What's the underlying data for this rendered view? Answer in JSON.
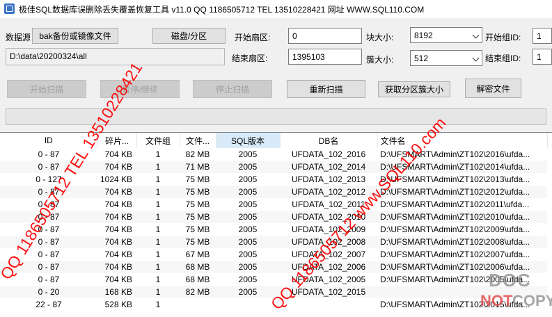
{
  "window": {
    "title": "极佳SQL数据库误删除丢失覆盖恢复工具 v11.0 QQ 1186505712 TEL 13510228421 网址 WWW.SQL110.COM",
    "icon": "app-icon"
  },
  "form": {
    "datasource_label": "数据源",
    "bak_button": "bak备份或镜像文件",
    "disk_button": "磁盘/分区",
    "path_value": "D:\\data\\20200324\\all",
    "start_sector_label": "开始扇区:",
    "start_sector_value": "0",
    "end_sector_label": "结束扇区:",
    "end_sector_value": "1395103",
    "block_size_label": "块大小:",
    "block_size_value": "8192",
    "cluster_size_label": "簇大小:",
    "cluster_size_value": "512",
    "start_group_label": "开始组ID:",
    "start_group_value": "1",
    "end_group_label": "结束组ID:",
    "end_group_value": "1"
  },
  "toolbar": {
    "start_scan": "开始扫描",
    "pause_resume": "暂停/继续",
    "stop_scan": "停止扫描",
    "rescan": "重新扫描",
    "get_cluster_size": "获取分区簇大小",
    "decrypt_file": "解密文件"
  },
  "progress": {
    "value": 0
  },
  "table": {
    "columns": [
      "ID",
      "碎片...",
      "文件组",
      "文件...",
      "SQL版本",
      "DB名",
      "文件名"
    ],
    "rows": [
      [
        "0 - 87",
        "704 KB",
        "1",
        "82 MB",
        "2005",
        "UFDATA_102_2016",
        "D:\\UFSMART\\Admin\\ZT102\\2016\\ufda..."
      ],
      [
        "0 - 87",
        "704 KB",
        "1",
        "71 MB",
        "2005",
        "UFDATA_102_2014",
        "D:\\UFSMART\\Admin\\ZT102\\2014\\ufda..."
      ],
      [
        "0 - 127",
        "1024 KB",
        "1",
        "75 MB",
        "2005",
        "UFDATA_102_2013",
        "D:\\UFSMART\\Admin\\ZT102\\2013\\ufda..."
      ],
      [
        "0 - 87",
        "704 KB",
        "1",
        "75 MB",
        "2005",
        "UFDATA_102_2012",
        "D:\\UFSMART\\Admin\\ZT102\\2012\\ufda..."
      ],
      [
        "0 - 87",
        "704 KB",
        "1",
        "75 MB",
        "2005",
        "UFDATA_102_2011",
        "D:\\UFSMART\\Admin\\ZT102\\2011\\ufda..."
      ],
      [
        "0 - 87",
        "704 KB",
        "1",
        "75 MB",
        "2005",
        "UFDATA_102_2010",
        "D:\\UFSMART\\Admin\\ZT102\\2010\\ufda..."
      ],
      [
        "0 - 87",
        "704 KB",
        "1",
        "75 MB",
        "2005",
        "UFDATA_102_2009",
        "D:\\UFSMART\\Admin\\ZT102\\2009\\ufda..."
      ],
      [
        "0 - 87",
        "704 KB",
        "1",
        "75 MB",
        "2005",
        "UFDATA_102_2008",
        "D:\\UFSMART\\Admin\\ZT102\\2008\\ufda..."
      ],
      [
        "0 - 87",
        "704 KB",
        "1",
        "67 MB",
        "2005",
        "UFDATA_102_2007",
        "D:\\UFSMART\\Admin\\ZT102\\2007\\ufda..."
      ],
      [
        "0 - 87",
        "704 KB",
        "1",
        "68 MB",
        "2005",
        "UFDATA_102_2006",
        "D:\\UFSMART\\Admin\\ZT102\\2006\\ufda..."
      ],
      [
        "0 - 87",
        "704 KB",
        "1",
        "68 MB",
        "2005",
        "UFDATA_102_2005",
        "D:\\UFSMART\\Admin\\ZT102\\2005\\ufda..."
      ],
      [
        "0 - 20",
        "168 KB",
        "1",
        "82 MB",
        "2005",
        "UFDATA_102_2015",
        ""
      ],
      [
        "22 - 87",
        "528 KB",
        "1",
        "",
        "",
        "",
        "D:\\UFSMART\\Admin\\ZT102\\2015\\ufda..."
      ]
    ]
  },
  "watermarks": {
    "left": "QQ 1186505712 TEL 13510228421",
    "center": "QQ 1186505712 www.SQL110.com",
    "logo_top": "DOC",
    "logo_bottom_not": "NOT",
    "logo_bottom_copy": "COPY"
  },
  "colors": {
    "watermark": "#ff0000",
    "selected_header": "#d9ebf9",
    "progress_fill": "#06b025"
  }
}
